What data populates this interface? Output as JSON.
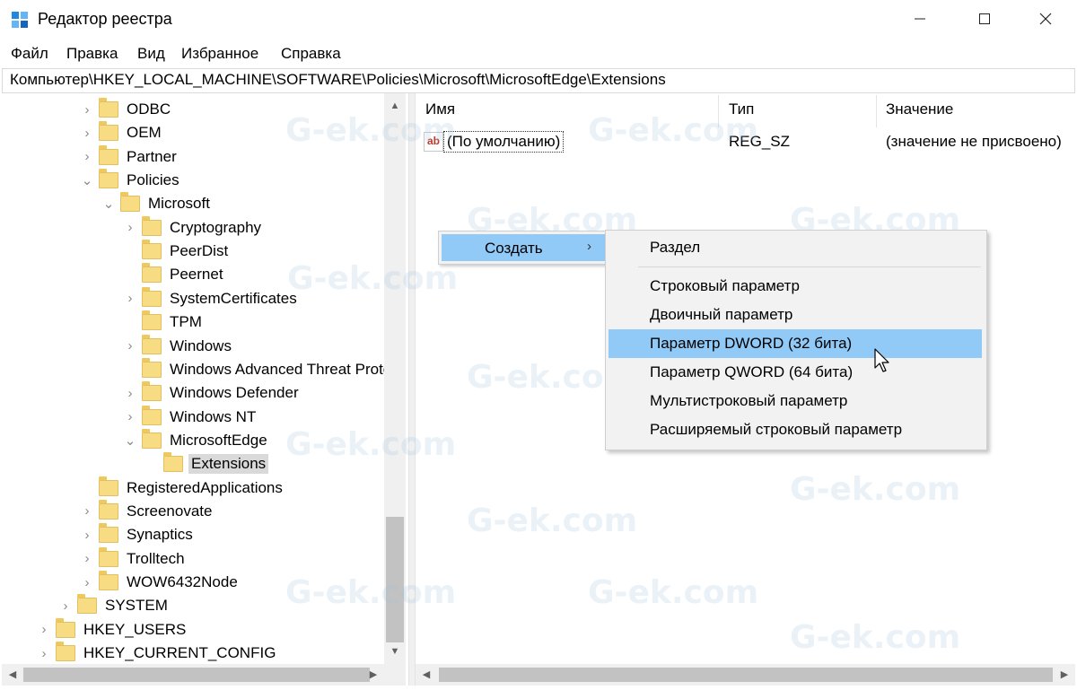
{
  "window": {
    "title": "Редактор реестра",
    "minimize_icon": "minimize-icon",
    "maximize_icon": "maximize-icon",
    "close_icon": "close-icon"
  },
  "menu": [
    "Файл",
    "Правка",
    "Вид",
    "Избранное",
    "Справка"
  ],
  "address": "Компьютер\\HKEY_LOCAL_MACHINE\\SOFTWARE\\Policies\\Microsoft\\MicrosoftEdge\\Extensions",
  "tree": [
    {
      "label": "ODBC",
      "expander": "collapsed"
    },
    {
      "label": "OEM",
      "expander": "collapsed"
    },
    {
      "label": "Partner",
      "expander": "collapsed"
    },
    {
      "label": "Policies",
      "expander": "expanded"
    },
    {
      "label": "Microsoft",
      "expander": "expanded"
    },
    {
      "label": "Cryptography",
      "expander": "collapsed"
    },
    {
      "label": "PeerDist",
      "expander": "none"
    },
    {
      "label": "Peernet",
      "expander": "none"
    },
    {
      "label": "SystemCertificates",
      "expander": "collapsed"
    },
    {
      "label": "TPM",
      "expander": "none"
    },
    {
      "label": "Windows",
      "expander": "collapsed"
    },
    {
      "label": "Windows Advanced Threat Prote",
      "expander": "none"
    },
    {
      "label": "Windows Defender",
      "expander": "collapsed"
    },
    {
      "label": "Windows NT",
      "expander": "collapsed"
    },
    {
      "label": "MicrosoftEdge",
      "expander": "expanded"
    },
    {
      "label": "Extensions",
      "expander": "none",
      "selected": true
    },
    {
      "label": "RegisteredApplications",
      "expander": "none"
    },
    {
      "label": "Screenovate",
      "expander": "collapsed"
    },
    {
      "label": "Synaptics",
      "expander": "collapsed"
    },
    {
      "label": "Trolltech",
      "expander": "collapsed"
    },
    {
      "label": "WOW6432Node",
      "expander": "collapsed"
    },
    {
      "label": "SYSTEM",
      "expander": "collapsed"
    },
    {
      "label": "HKEY_USERS",
      "expander": "collapsed"
    },
    {
      "label": "HKEY_CURRENT_CONFIG",
      "expander": "collapsed"
    }
  ],
  "columns": {
    "name": "Имя",
    "type": "Тип",
    "value": "Значение"
  },
  "values": [
    {
      "icon": "ab",
      "name": "(По умолчанию)",
      "type": "REG_SZ",
      "value": "(значение не присвоено)"
    }
  ],
  "context_menu": {
    "create_label": "Создать",
    "submenu_arrow": "›"
  },
  "submenu": [
    "Раздел",
    "Строковый параметр",
    "Двоичный параметр",
    "Параметр DWORD (32 бита)",
    "Параметр QWORD (64 бита)",
    "Мультистроковый параметр",
    "Расширяемый строковый параметр"
  ],
  "highlight_color": "#91c9f7",
  "watermark": "G-ek.com"
}
